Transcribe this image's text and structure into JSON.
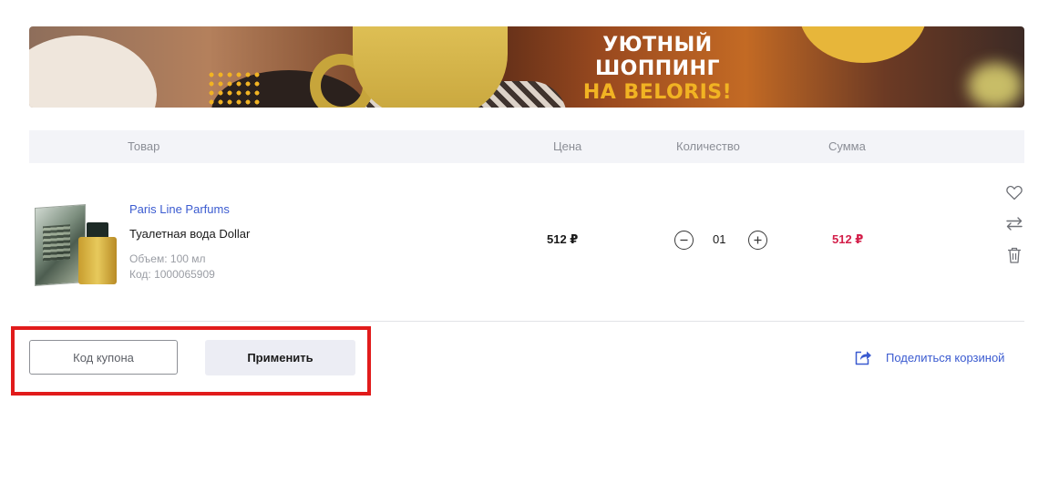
{
  "banner": {
    "line1": "УЮТНЫЙ",
    "line2": "ШОППИНГ",
    "line3": "НА BELORIS!"
  },
  "table_header": {
    "product": "Товар",
    "price": "Цена",
    "quantity": "Количество",
    "sum": "Сумма"
  },
  "item": {
    "brand": "Paris Line Parfums",
    "name": "Туалетная вода Dollar",
    "volume": "Объем: 100 мл",
    "code": "Код: 1000065909",
    "price": "512 ₽",
    "quantity": "01",
    "sum": "512 ₽"
  },
  "coupon": {
    "placeholder": "Код купона",
    "apply_label": "Применить"
  },
  "share": {
    "label": "Поделиться корзиной"
  },
  "colors": {
    "accent_blue": "#3b5bd0",
    "sum_red": "#d31f4a",
    "highlight_red": "#e11b1b"
  }
}
